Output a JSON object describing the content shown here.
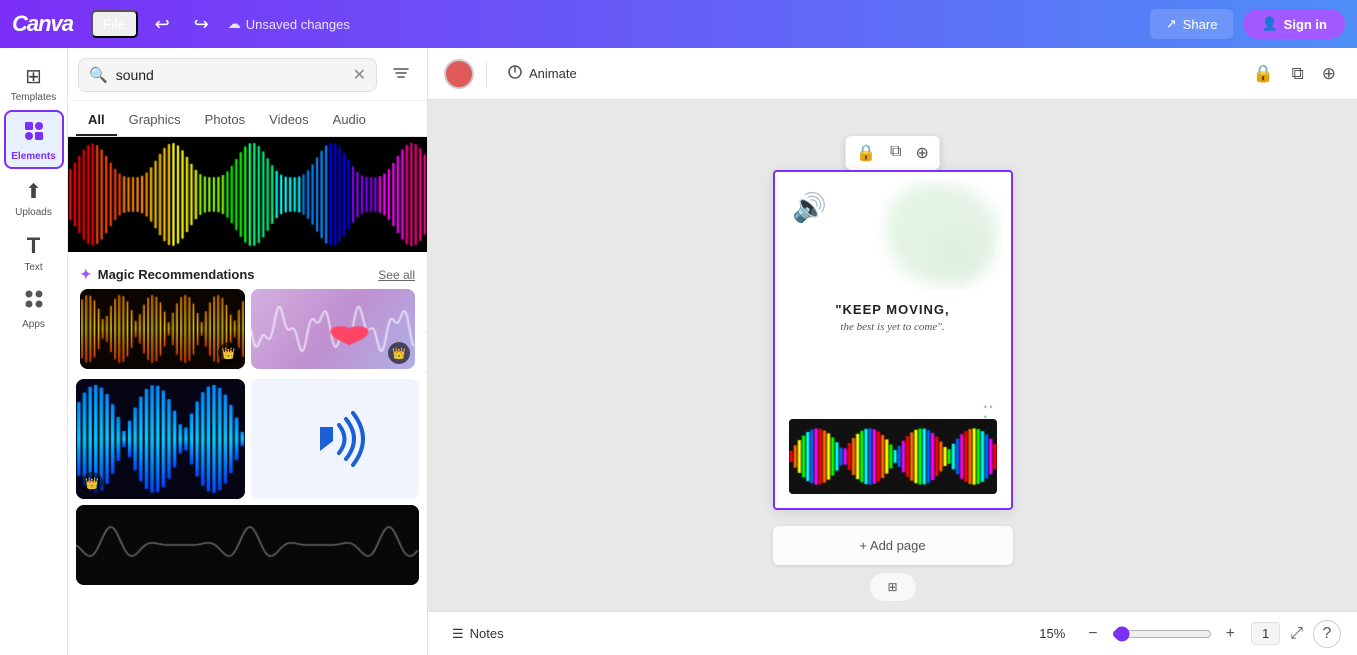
{
  "topbar": {
    "logo": "Canva",
    "file_label": "File",
    "undo_icon": "↩",
    "redo_icon": "↪",
    "unsaved_icon": "⚠",
    "unsaved_text": "Unsaved changes",
    "share_label": "Share",
    "signin_label": "Sign in"
  },
  "sidebar": {
    "items": [
      {
        "id": "templates",
        "label": "Templates",
        "icon": "⊞"
      },
      {
        "id": "elements",
        "label": "Elements",
        "icon": "✦",
        "active": true
      },
      {
        "id": "uploads",
        "label": "Uploads",
        "icon": "⬆"
      },
      {
        "id": "text",
        "label": "Text",
        "icon": "T"
      },
      {
        "id": "apps",
        "label": "Apps",
        "icon": "⊙"
      }
    ]
  },
  "panel": {
    "search_placeholder": "sound",
    "search_value": "sound",
    "tabs": [
      {
        "id": "all",
        "label": "All",
        "active": true
      },
      {
        "id": "graphics",
        "label": "Graphics"
      },
      {
        "id": "photos",
        "label": "Photos"
      },
      {
        "id": "videos",
        "label": "Videos"
      },
      {
        "id": "audio",
        "label": "Audio"
      }
    ],
    "magic_rec": {
      "title": "Magic Recommendations",
      "see_all": "See all",
      "items": [
        {
          "id": "rec1",
          "type": "gold-waveform",
          "has_crown": true
        },
        {
          "id": "rec2",
          "type": "heart-waveform",
          "has_crown": true
        }
      ]
    },
    "grid_items": [
      {
        "id": "g1",
        "type": "blue-wave",
        "has_crown": true
      },
      {
        "id": "g2",
        "type": "sound-icon"
      },
      {
        "id": "g3",
        "type": "partial-wave"
      }
    ]
  },
  "canvas": {
    "design": {
      "quote_main": "\"KEEP MOVING,",
      "quote_sub": "the best is yet to come\".",
      "sound_icon": "🔊",
      "add_page_label": "+ Add page",
      "dots": "• • •"
    },
    "toolbar": {
      "animate_label": "Animate",
      "animate_icon": "⬟"
    }
  },
  "bottom": {
    "notes_label": "Notes",
    "notes_icon": "☰",
    "zoom_percent": "15%",
    "page_number": "1",
    "zoom_value": 15
  },
  "colors": {
    "accent": "#7b2ff7",
    "active_border": "#7b2ff7"
  }
}
